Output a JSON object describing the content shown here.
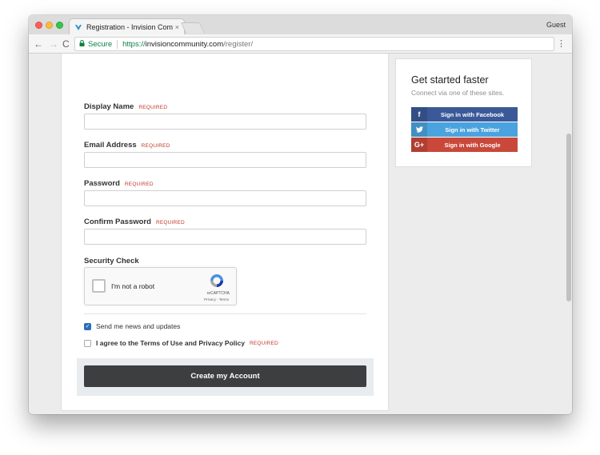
{
  "browser": {
    "tab_title": "Registration - Invision Commu",
    "tab_close": "×",
    "profile": "Guest",
    "nav": {
      "back": "←",
      "forward": "→",
      "reload": "C"
    },
    "omnibox": {
      "secure_label": "Secure",
      "url_scheme": "https://",
      "url_host": "invisioncommunity.com",
      "url_path": "/register/"
    },
    "menu_glyph": "⋮"
  },
  "form": {
    "required_tag": "REQUIRED",
    "fields": [
      {
        "label": "Display Name",
        "value": ""
      },
      {
        "label": "Email Address",
        "value": ""
      },
      {
        "label": "Password",
        "value": ""
      },
      {
        "label": "Confirm Password",
        "value": ""
      }
    ],
    "security_label": "Security Check",
    "recaptcha": {
      "text": "I'm not a robot",
      "brand": "reCAPTCHA",
      "links": "Privacy - Terms"
    },
    "newsletter": {
      "label": "Send me news and updates",
      "checked": true,
      "check_glyph": "✓"
    },
    "terms": {
      "label": "I agree to the Terms of Use and Privacy Policy",
      "checked": false
    },
    "submit_label": "Create my Account"
  },
  "sidebar": {
    "title": "Get started faster",
    "subtitle": "Connect via one of these sites.",
    "buttons": [
      {
        "icon": "f",
        "label": "Sign in with Facebook",
        "color": "#3b5998"
      },
      {
        "icon": "t",
        "label": "Sign in with Twitter",
        "color": "#4aa3df"
      },
      {
        "icon": "G+",
        "label": "Sign in with Google",
        "color": "#c9483a"
      }
    ]
  },
  "colors": {
    "required": "#c0392b",
    "secure_green": "#0b8043",
    "submit_bg": "#3d3e40"
  }
}
